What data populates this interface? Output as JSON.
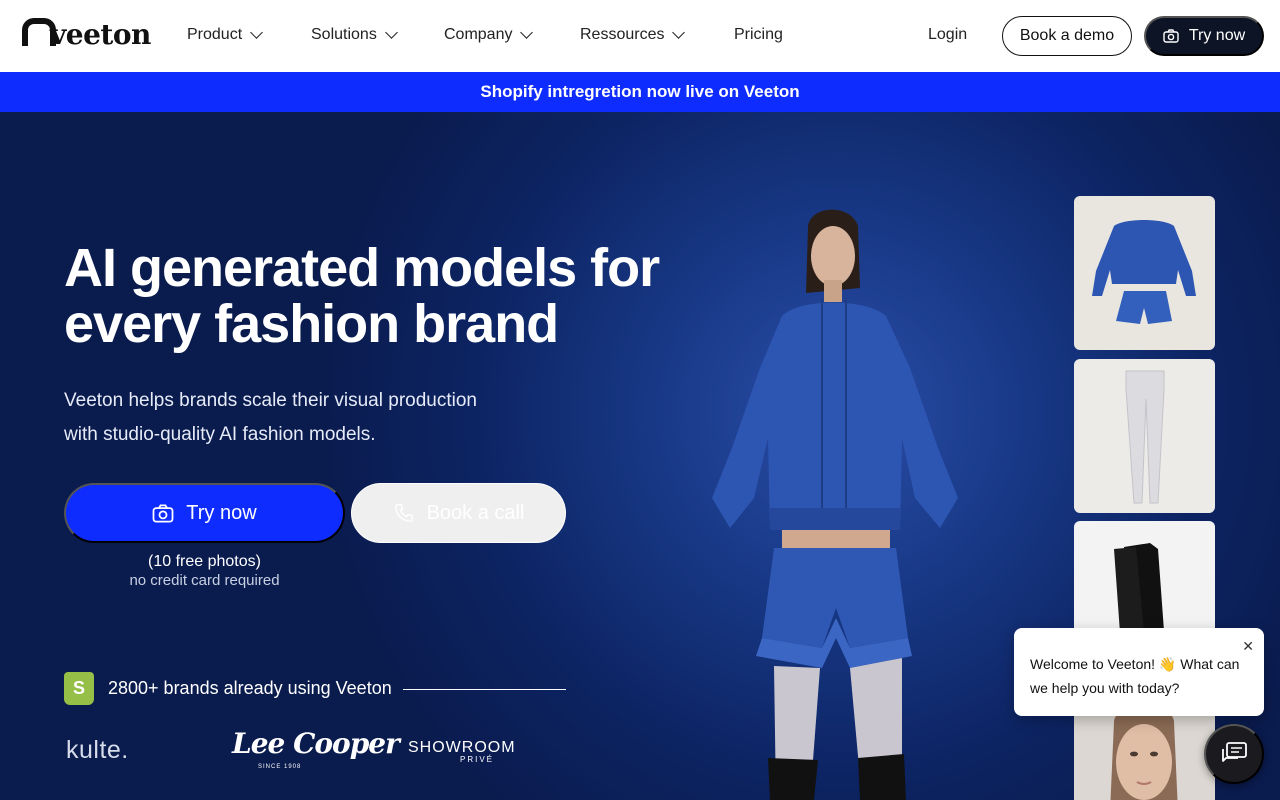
{
  "nav": {
    "logo_text": "veeton",
    "items": [
      {
        "label": "Product"
      },
      {
        "label": "Solutions"
      },
      {
        "label": "Company"
      },
      {
        "label": "Ressources"
      },
      {
        "label": "Pricing"
      }
    ],
    "login_label": "Login",
    "demo_label": "Book a demo",
    "try_label": "Try now"
  },
  "banner": {
    "text": "Shopify intregretion now live on Veeton"
  },
  "hero": {
    "title_line1": "AI generated models for",
    "title_line2": "every fashion brand",
    "subtitle_line1": "Veeton helps brands scale their visual production",
    "subtitle_line2": "with studio-quality AI fashion models.",
    "try_label": "Try now",
    "call_label": "Book a call",
    "free_note": "(10 free photos)",
    "no_card_note": "no credit card required"
  },
  "brands": {
    "text": "2800+ brands already using Veeton",
    "logos": [
      "kulte.",
      "Lee Cooper",
      "SHOWROOM",
      "PRIVÉ",
      "SINCE 1908"
    ]
  },
  "chat": {
    "line1": "Welcome to Veeton! 👋 What can",
    "line2": "we help you with today?",
    "close": "✕"
  },
  "colors": {
    "accent": "#0f2cff",
    "nav_dark": "#0d1426",
    "hero_bg": "#0d2463",
    "jacket_blue": "#2d56b3"
  }
}
